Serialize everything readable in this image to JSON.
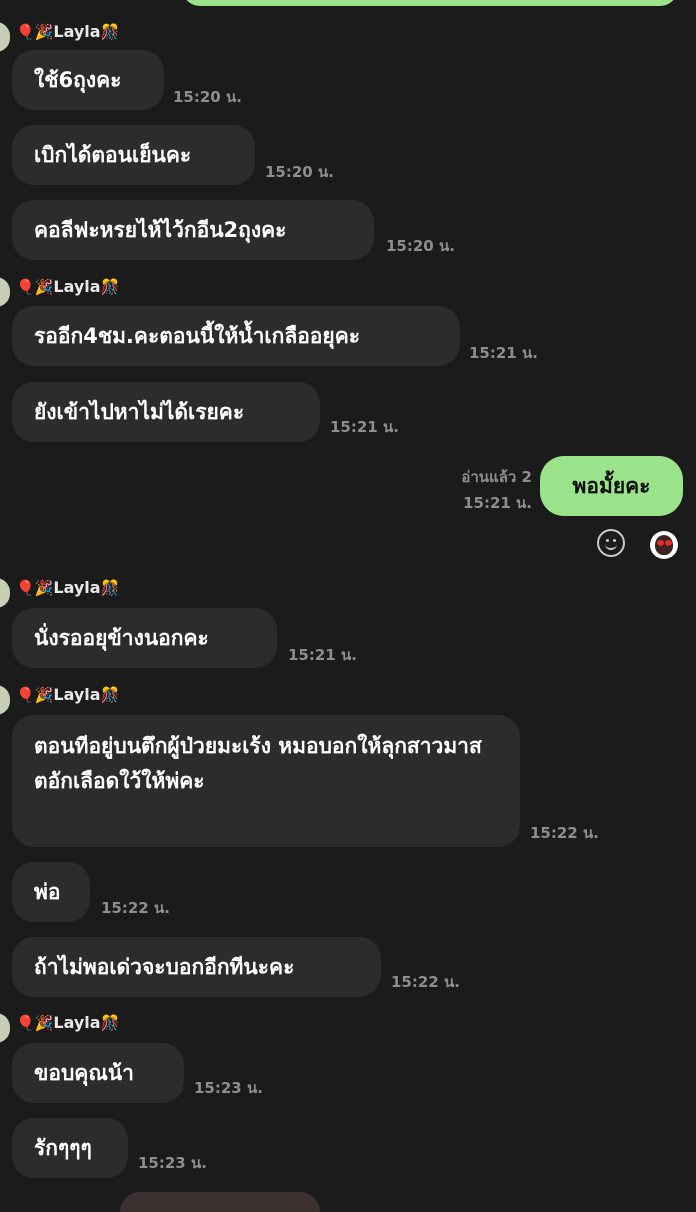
{
  "sender": {
    "name": "Layla",
    "balloon": "🎈",
    "party": "🎉",
    "confetti": "🎊"
  },
  "messages": [
    {
      "text": "ใช้6ถุงคะ",
      "time": "15:20 น."
    },
    {
      "text": "เบิกได้ตอนเย็นคะ",
      "time": "15:20 น."
    },
    {
      "text": "คอลีฟะหรยไห้ไว้กอีน2ถุงคะ",
      "time": "15:20 น."
    },
    {
      "text": "รออีก4ชม.คะตอนนี้ให้น้ำเกลืออยุคะ",
      "time": "15:21 น."
    },
    {
      "text": "ยังเข้าไปหาไม่ได้เรยคะ",
      "time": "15:21 น."
    },
    {
      "text": "นั่งรออยุข้างนอกคะ",
      "time": "15:21 น."
    },
    {
      "text": "ตอนทีอยู่บนตึกผู้ป่วยมะเร้ง หมอบอกให้ลุกสาวมาสตอักเลือดใว้ให้พ่คะ",
      "time": "15:22 น."
    },
    {
      "text": "พ่อ",
      "time": "15:22 น."
    },
    {
      "text": "ถ้าไม่พอเด่วจะบอกอีกทีนะคะ",
      "time": "15:22 น."
    },
    {
      "text": "ขอบคุณน้า",
      "time": "15:23 น."
    },
    {
      "text": "รักๆๆๆ",
      "time": "15:23 น."
    }
  ],
  "outgoing": {
    "text": "พอมั้ยคะ",
    "read_status": "อ่านแล้ว 2",
    "time": "15:21 น."
  },
  "icons": {
    "smile": "smiley-react-icon",
    "reaction": "heart-eyes-reaction-icon"
  },
  "colors": {
    "background": "#1b1b1b",
    "incoming_bubble": "#2c2c2c",
    "outgoing_bubble": "#9be38a",
    "timestamp": "#8e8e8e"
  }
}
